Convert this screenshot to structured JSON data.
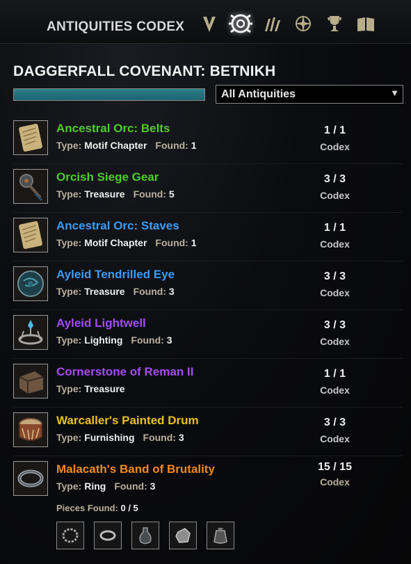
{
  "header": {
    "title": "ANTIQUITIES CODEX",
    "tabs": [
      {
        "icon": "covenant-emblem-icon",
        "active": false
      },
      {
        "icon": "antiquities-codex-icon",
        "active": true
      },
      {
        "icon": "scrolls-icon",
        "active": false
      },
      {
        "icon": "compass-star-icon",
        "active": false
      },
      {
        "icon": "trophy-icon",
        "active": false
      },
      {
        "icon": "book-icon",
        "active": false
      }
    ]
  },
  "zone": {
    "title": "DAGGERFALL COVENANT: BETNIKH",
    "progress": 1.0,
    "progress_color": "#2d7e8c"
  },
  "filter": {
    "selected": "All Antiquities",
    "arrow": "▼"
  },
  "labels": {
    "type": "Type:",
    "found": "Found:",
    "pieces_found": "Pieces Found:"
  },
  "colors": {
    "green": "#4fcb2a",
    "blue": "#3d9cf5",
    "purple": "#a34df0",
    "gold": "#e8c028",
    "orange": "#f08a1e"
  },
  "antiquities": [
    {
      "name": "Ancestral Orc: Belts",
      "color": "green",
      "icon": "scroll-icon",
      "type": "Motif Chapter",
      "found": "1",
      "count": "1 / 1",
      "codex": "Codex"
    },
    {
      "name": "Orcish Siege Gear",
      "color": "green",
      "icon": "siege-gear-icon",
      "type": "Treasure",
      "found": "5",
      "count": "3 / 3",
      "codex": "Codex"
    },
    {
      "name": "Ancestral Orc: Staves",
      "color": "blue",
      "icon": "scroll-icon",
      "type": "Motif Chapter",
      "found": "1",
      "count": "1 / 1",
      "codex": "Codex"
    },
    {
      "name": "Ayleid Tendrilled Eye",
      "color": "blue",
      "icon": "orb-icon",
      "type": "Treasure",
      "found": "3",
      "count": "3 / 3",
      "codex": "Codex"
    },
    {
      "name": "Ayleid Lightwell",
      "color": "purple",
      "icon": "lightwell-icon",
      "type": "Lighting",
      "found": "3",
      "count": "3 / 3",
      "codex": "Codex"
    },
    {
      "name": "Cornerstone of Reman II",
      "color": "purple",
      "icon": "stone-block-icon",
      "type": "Treasure",
      "found": "",
      "count": "1 / 1",
      "codex": "Codex"
    },
    {
      "name": "Warcaller's Painted Drum",
      "color": "gold",
      "icon": "drum-icon",
      "type": "Furnishing",
      "found": "3",
      "count": "3 / 3",
      "codex": "Codex"
    },
    {
      "name": "Malacath's Band of Brutality",
      "color": "orange",
      "icon": "ring-icon",
      "type": "Ring",
      "found": "3",
      "count": "15 / 15",
      "codex": "Codex"
    }
  ],
  "pieces": {
    "value": "0 / 5",
    "slots": [
      "bracelet-icon",
      "band-icon",
      "vial-icon",
      "gem-icon",
      "pouch-icon"
    ]
  }
}
